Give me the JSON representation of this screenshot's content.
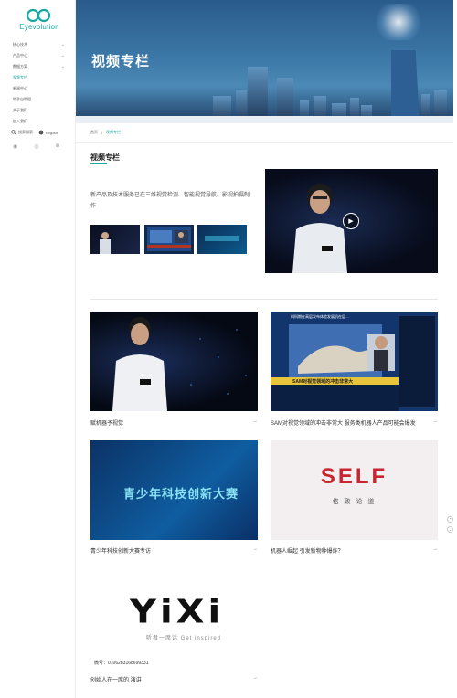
{
  "brand": {
    "logo_text": "Eyevolution",
    "accent": "#19a8a0"
  },
  "sidebar": {
    "items": [
      {
        "label": "核心技术",
        "chevron": true,
        "active": false
      },
      {
        "label": "产品中心",
        "chevron": true,
        "active": false
      },
      {
        "label": "数据方案",
        "chevron": true,
        "active": false
      },
      {
        "label": "视频专栏",
        "chevron": false,
        "active": true
      },
      {
        "label": "新闻中心",
        "chevron": false,
        "active": false
      },
      {
        "label": "助手自助租",
        "chevron": false,
        "active": false
      },
      {
        "label": "关于我们",
        "chevron": false,
        "active": false
      },
      {
        "label": "加入我们",
        "chevron": false,
        "active": false
      }
    ],
    "links": {
      "search": "搜索搜索",
      "language": "English"
    },
    "social_icons": [
      "wechat-icon",
      "weibo-icon",
      "linkedin-icon"
    ],
    "social_glyphs": [
      "◉",
      "◎",
      "in"
    ]
  },
  "hero": {
    "title": "视频专栏"
  },
  "breadcrumb": {
    "home": "首页",
    "sep": "|",
    "current": "视频专栏"
  },
  "section": {
    "title": "视频专栏",
    "intro": "新产品及技术服务已在三维视觉检测、智能视觉导航、影视拍摄制作"
  },
  "cards": [
    {
      "caption": "赋机器予视觉"
    },
    {
      "caption": "SAM对视觉领域的冲击非常大 服务类机器人产品可能会爆发"
    },
    {
      "caption": "青少年科技创新大赛专访"
    },
    {
      "caption": "机器人崛起 引发新物种爆炸？"
    }
  ],
  "card_images": {
    "tv_headline": "科科期在高层发布体验发展机在层…",
    "tv_banner": "SAM对视觉领域的冲击非常大",
    "contest_text": "青少年科技创新大赛",
    "self_logo": "SELF",
    "self_sub": "格 致 论 道"
  },
  "yixi": {
    "logo": "YiXi",
    "tagline": "听君一席话   Get inspired",
    "account": "微号：0106283168699331",
    "caption": "创始人在一席的 演讲"
  },
  "arrow": "→",
  "play_glyph": "▶"
}
